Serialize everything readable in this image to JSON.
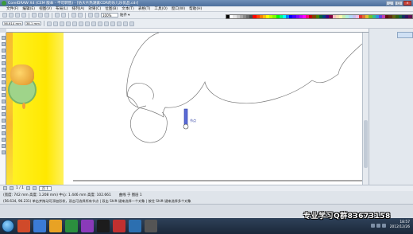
{
  "window": {
    "title": "CorelDRAW X4 (CEM 版本 - 不可转售) - [仿大片热潮素CDR的乐儿乐优品.cdr]",
    "controls": [
      "_",
      "□",
      "×"
    ]
  },
  "menu": [
    "文件(F)",
    "编辑(E)",
    "视图(V)",
    "布局(L)",
    "排列(A)",
    "效果(C)",
    "位图(B)",
    "文本(T)",
    "表格(T)",
    "工具(O)",
    "窗口(W)",
    "帮助(H)"
  ],
  "toolbar": {
    "zoom": "100%",
    "snap_label": "贴齐 ▾",
    "x_field": "56.614 mm",
    "y_field": "38.1 mm"
  },
  "palette_colors": [
    "#000000",
    "#ffffff",
    "#e6e6e6",
    "#c8c8c8",
    "#aaaaaa",
    "#8c8c8c",
    "#6e6e6e",
    "#4b4b4b",
    "#ff0000",
    "#ff4000",
    "#ff8000",
    "#ffbf00",
    "#ffff00",
    "#bfff00",
    "#80ff00",
    "#00ff00",
    "#00ff80",
    "#00ffff",
    "#0080ff",
    "#0000ff",
    "#4000ff",
    "#8000ff",
    "#bf00ff",
    "#ff00ff",
    "#ff0080",
    "#c00000",
    "#804000",
    "#408000",
    "#006040",
    "#004080",
    "#400080",
    "#800040",
    "#f8c0c0",
    "#f8e0b0",
    "#f8f8b0",
    "#c8f0b0",
    "#b0f0e0",
    "#b0d8f8",
    "#c8c0f0",
    "#f0c0e8",
    "#e03030",
    "#e07030",
    "#e0c030",
    "#70c030",
    "#30c090",
    "#3090e0",
    "#6040e0",
    "#c040b0",
    "#601010",
    "#603010",
    "#606010",
    "#306010",
    "#106040",
    "#103060",
    "#301060",
    "#601050"
  ],
  "canvas": {
    "handle_label": "节点"
  },
  "pagebar": {
    "count": "1 / 1",
    "tab": "页 1"
  },
  "status": {
    "line1_dims": "(宽度: 742 mm 高度: 1.208 mm) 中心: 1.446 mm 高度: 102.661",
    "line1_object": "曲线 于 图层 1",
    "line2": "(56.634, 96.231) 单击并拖动可添加形状，双击可选择所有节点 | 双击 Shift 键来选择一个对象 | 按住 Shift 键来选择多个对象"
  },
  "taskbar": {
    "time": "18:57",
    "date": "2012/12/26"
  },
  "watermark": "专业学习Q群83673158"
}
